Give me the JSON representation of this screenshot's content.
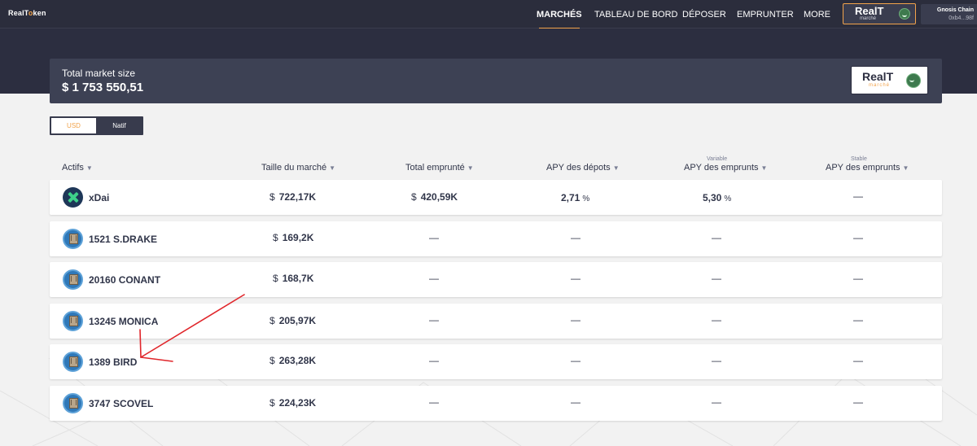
{
  "brand": {
    "logo_text_a": "RealT",
    "logo_text_o": "o",
    "logo_text_b": "ken"
  },
  "nav": {
    "items": [
      "MARCHÉS",
      "TABLEAU DE BORD",
      "DÉPOSER",
      "EMPRUNTER",
      "MORE"
    ],
    "active": "MARCHÉS",
    "market_logo_title": "RealT",
    "market_logo_sub": "marché",
    "network_name": "Gnosis Chain",
    "wallet_short": "0xb4...98f"
  },
  "summary": {
    "label": "Total market size",
    "value": "$ 1 753 550,51",
    "logo_title": "RealT",
    "logo_sub": "marché"
  },
  "currency_toggle": {
    "options": [
      "USD",
      "Natif"
    ],
    "selected": "USD"
  },
  "table": {
    "headers": {
      "assets": "Actifs",
      "market_size": "Taille du marché",
      "total_borrowed": "Total emprunté",
      "deposit_apy": "APY des dépots",
      "variable_label": "Variable",
      "variable_borrow_apy": "APY des emprunts",
      "stable_label": "Stable",
      "stable_borrow_apy": "APY des emprunts"
    },
    "currency_symbol": "$",
    "percent_symbol": "%",
    "dash": "—",
    "rows": [
      {
        "icon": "xdai-icon",
        "name": "xDai",
        "market_size": "722,17K",
        "total_borrowed": "420,59K",
        "deposit_apy": "2,71",
        "variable_apy": "5,30",
        "stable_apy": "—"
      },
      {
        "icon": "property-token-icon",
        "name": "1521 S.DRAKE",
        "market_size": "169,2K",
        "total_borrowed": "—",
        "deposit_apy": "—",
        "variable_apy": "—",
        "stable_apy": "—"
      },
      {
        "icon": "property-token-icon",
        "name": "20160 CONANT",
        "market_size": "168,7K",
        "total_borrowed": "—",
        "deposit_apy": "—",
        "variable_apy": "—",
        "stable_apy": "—"
      },
      {
        "icon": "property-token-icon",
        "name": "13245 MONICA",
        "market_size": "205,97K",
        "total_borrowed": "—",
        "deposit_apy": "—",
        "variable_apy": "—",
        "stable_apy": "—"
      },
      {
        "icon": "property-token-icon",
        "name": "1389 BIRD",
        "market_size": "263,28K",
        "total_borrowed": "—",
        "deposit_apy": "—",
        "variable_apy": "—",
        "stable_apy": "—"
      },
      {
        "icon": "property-token-icon",
        "name": "3747 SCOVEL",
        "market_size": "224,23K",
        "total_borrowed": "—",
        "deposit_apy": "—",
        "variable_apy": "—",
        "stable_apy": "—"
      }
    ]
  },
  "annotation": {
    "color": "#e0262b"
  },
  "colors": {
    "accent": "#f2a34b",
    "dark_bg": "#2c2e40",
    "panel": "#3d4154",
    "page_bg": "#f2f2f2"
  }
}
